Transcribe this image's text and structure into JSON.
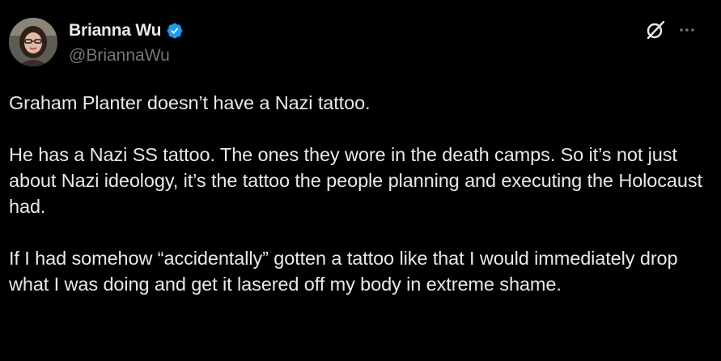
{
  "colors": {
    "background": "#000000",
    "text_primary": "#e7e9ea",
    "text_secondary": "#71767b",
    "verified_blue": "#1d9bf0"
  },
  "author": {
    "display_name": "Brianna Wu",
    "handle": "@BriannaWu",
    "verified": true,
    "avatar_icon": "profile-photo"
  },
  "header_actions": {
    "grok_icon": "grok-icon",
    "more_icon": "more-horizontal-icon"
  },
  "tweet": {
    "paragraphs": [
      "Graham Planter doesn’t have a Nazi tattoo.",
      "He has a Nazi SS tattoo. The ones they wore in the death camps. So it’s not just about Nazi ideology, it’s the tattoo the people planning and executing the Holocaust had.",
      "If I had somehow “accidentally” gotten a tattoo like that I would immediately drop what I was doing and get it lasered off my body in extreme shame."
    ]
  }
}
